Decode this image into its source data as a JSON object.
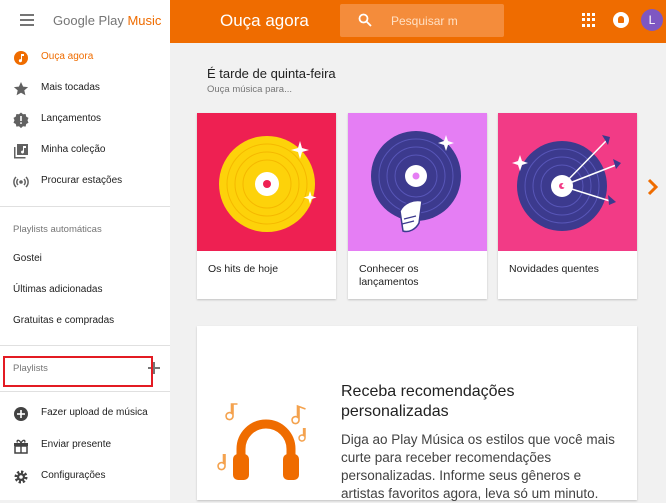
{
  "app": {
    "logo_prefix": "Google Play ",
    "logo_brand": "Music"
  },
  "header": {
    "title": "Ouça agora",
    "search_placeholder": "Pesquisar m",
    "avatar_letter": "L",
    "accent": "#ef6c00"
  },
  "sidebar": {
    "nav": [
      {
        "label": "Ouça agora",
        "icon": "listen-now-icon",
        "active": true
      },
      {
        "label": "Mais tocadas",
        "icon": "star-icon"
      },
      {
        "label": "Lançamentos",
        "icon": "new-releases-icon"
      },
      {
        "label": "Minha coleção",
        "icon": "library-icon"
      },
      {
        "label": "Procurar estações",
        "icon": "radio-icon"
      }
    ],
    "auto_playlists_label": "Playlists automáticas",
    "auto_playlists": [
      "Gostei",
      "Últimas adicionadas",
      "Gratuitas e compradas"
    ],
    "playlists_label": "Playlists",
    "bottom": [
      {
        "label": "Fazer upload de música",
        "icon": "add-circle-icon"
      },
      {
        "label": "Enviar presente",
        "icon": "gift-icon"
      },
      {
        "label": "Configurações",
        "icon": "gear-icon"
      }
    ]
  },
  "main": {
    "greeting_title": "É tarde de quinta-feira",
    "greeting_sub": "Ouça música para...",
    "cards": [
      {
        "title": "Os hits de hoje",
        "bg": "#ee2052"
      },
      {
        "title": "Conhecer os lançamentos",
        "bg": "#e57ef4"
      },
      {
        "title": "Novidades quentes",
        "bg": "#f23b86"
      }
    ],
    "reco_title": "Receba recomendações personalizadas",
    "reco_text": "Diga ao Play Música os estilos que você mais curte para receber recomendações personalizadas. Informe seus gêneros e artistas favoritos agora, leva só um minuto."
  }
}
